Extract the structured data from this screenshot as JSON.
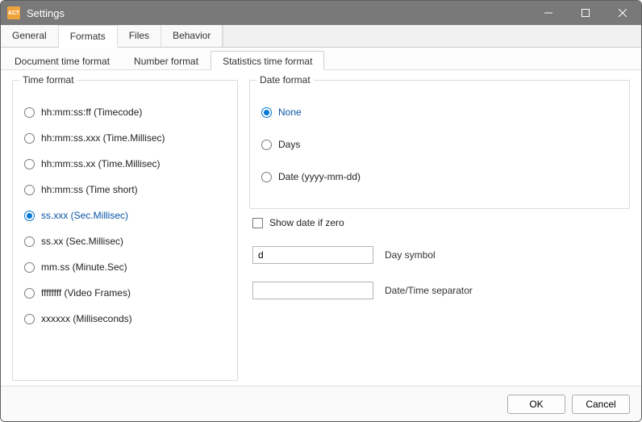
{
  "window": {
    "title": "Settings"
  },
  "top_tabs": {
    "general": "General",
    "formats": "Formats",
    "files": "Files",
    "behavior": "Behavior"
  },
  "sub_tabs": {
    "doc_time": "Document time format",
    "number": "Number format",
    "stats_time": "Statistics time format"
  },
  "time_format": {
    "legend": "Time format",
    "options": {
      "o0": "hh:mm:ss:ff (Timecode)",
      "o1": "hh:mm:ss.xxx (Time.Millisec)",
      "o2": "hh:mm:ss.xx (Time.Millisec)",
      "o3": "hh:mm:ss (Time short)",
      "o4": "ss.xxx (Sec.Millisec)",
      "o5": "ss.xx (Sec.Millisec)",
      "o6": "mm.ss (Minute.Sec)",
      "o7": "ffffffff (Video Frames)",
      "o8": "xxxxxx (Milliseconds)"
    }
  },
  "date_format": {
    "legend": "Date format",
    "options": {
      "none": "None",
      "days": "Days",
      "date": "Date (yyyy-mm-dd)"
    },
    "show_if_zero": "Show date if zero",
    "day_symbol_label": "Day symbol",
    "day_symbol_value": "d",
    "dt_sep_label": "Date/Time separator",
    "dt_sep_value": ""
  },
  "buttons": {
    "ok": "OK",
    "cancel": "Cancel"
  }
}
